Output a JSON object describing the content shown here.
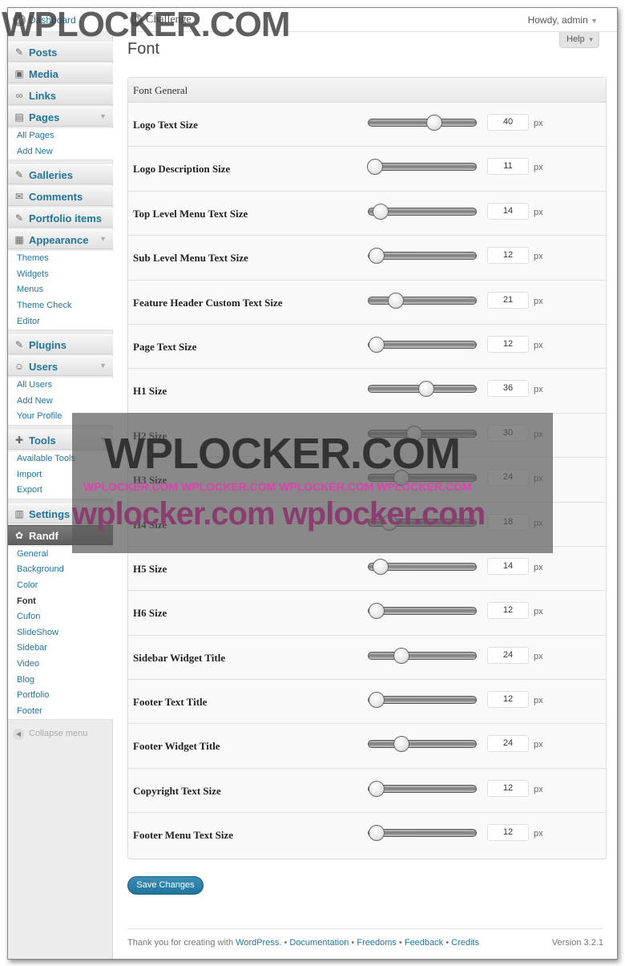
{
  "topbar": {
    "dashboard": "Dashboard",
    "site_name": "Challenge",
    "howdy": "Howdy, admin",
    "help": "Help"
  },
  "page_title": "Font",
  "sidebar": {
    "menus": [
      {
        "label": "Posts",
        "icon": "pin-icon"
      },
      {
        "label": "Media",
        "icon": "media-icon"
      },
      {
        "label": "Links",
        "icon": "link-icon"
      },
      {
        "label": "Pages",
        "icon": "pages-icon",
        "sub": [
          "All Pages",
          "Add New"
        ]
      },
      {
        "label": "Galleries",
        "icon": "pin-icon"
      },
      {
        "label": "Comments",
        "icon": "comment-icon"
      },
      {
        "label": "Portfolio items",
        "icon": "pin-icon"
      },
      {
        "label": "Appearance",
        "icon": "appearance-icon",
        "sub": [
          "Themes",
          "Widgets",
          "Menus",
          "Theme Check",
          "Editor"
        ]
      },
      {
        "label": "Plugins",
        "icon": "plugin-icon"
      },
      {
        "label": "Users",
        "icon": "users-icon",
        "sub": [
          "All Users",
          "Add New",
          "Your Profile"
        ]
      },
      {
        "label": "Tools",
        "icon": "tools-icon",
        "sub": [
          "Available Tools",
          "Import",
          "Export"
        ]
      },
      {
        "label": "Settings",
        "icon": "settings-icon"
      },
      {
        "label": "Randf",
        "icon": "gear-icon",
        "sub": [
          "General",
          "Background",
          "Color",
          "Font",
          "Cufon",
          "SlideShow",
          "Sidebar",
          "Video",
          "Blog",
          "Portfolio",
          "Footer"
        ]
      }
    ],
    "collapse": "Collapse menu"
  },
  "panel": {
    "heading": "Font General",
    "unit": "px",
    "min": 8,
    "max": 60,
    "rows": [
      {
        "label": "Logo Text Size",
        "value": "40"
      },
      {
        "label": "Logo Description Size",
        "value": "11"
      },
      {
        "label": "Top Level Menu Text Size",
        "value": "14"
      },
      {
        "label": "Sub Level Menu Text Size",
        "value": "12"
      },
      {
        "label": "Feature Header Custom Text Size",
        "value": "21"
      },
      {
        "label": "Page Text Size",
        "value": "12"
      },
      {
        "label": "H1 Size",
        "value": "36"
      },
      {
        "label": "H2 Size",
        "value": "30"
      },
      {
        "label": "H3 Size",
        "value": "24"
      },
      {
        "label": "H4 Size",
        "value": "18"
      },
      {
        "label": "H5 Size",
        "value": "14"
      },
      {
        "label": "H6 Size",
        "value": "12"
      },
      {
        "label": "Sidebar Widget Title",
        "value": "24"
      },
      {
        "label": "Footer Text Title",
        "value": "12"
      },
      {
        "label": "Footer Widget Title",
        "value": "24"
      },
      {
        "label": "Copyright Text Size",
        "value": "12"
      },
      {
        "label": "Footer Menu Text Size",
        "value": "12"
      }
    ]
  },
  "save_label": "Save Changes",
  "footer": {
    "thanks": "Thank you for creating with",
    "wordpress": "WordPress.",
    "links": [
      "Documentation",
      "Freedoms",
      "Feedback",
      "Credits"
    ],
    "version": "Version 3.2.1"
  },
  "watermark": {
    "top": "WPLOCKER.COM",
    "big": "WPLOCKER.COM",
    "mid": "WPLOCKER.COM WPLOCKER.COM WPLOCKER.COM WPLOCKER.COM",
    "low": "wplocker.com wplocker.com"
  }
}
